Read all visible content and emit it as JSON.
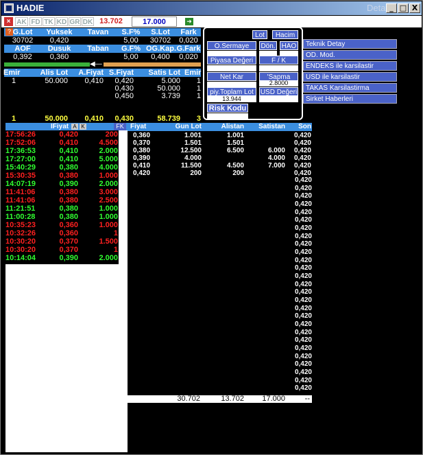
{
  "window": {
    "title": "HADIE",
    "detail": "Detay",
    "buttons": [
      "_",
      "□",
      "X"
    ]
  },
  "toolbar": {
    "tabs": [
      "AK",
      "FD",
      "TK",
      "KD",
      "GR",
      "DK"
    ],
    "price1": "13.702",
    "price2": "17.000"
  },
  "summary": {
    "row1_headers": [
      "G.Lot",
      "Yuksek",
      "Tavan",
      "S.F%",
      "S.Lot",
      "Fark"
    ],
    "row1_values": [
      "30702",
      "0,420",
      "",
      "5,00",
      "30702",
      "0,020"
    ],
    "row2_headers": [
      "AOF",
      "Dusuk",
      "Taban",
      "G.F%",
      "OG.Kap.",
      "G.Fark"
    ],
    "row2_values": [
      "0,392",
      "0,360",
      "",
      "5,00",
      "0,400",
      "0,020"
    ]
  },
  "order_book": {
    "headers": [
      "Emir",
      "Alis Lot",
      "A.Fiyat",
      "S.Fiyat",
      "Satis Lot",
      "Emir"
    ],
    "rows": [
      [
        "1",
        "50.000",
        "0,410",
        "0,420",
        "5.000",
        "1"
      ],
      [
        "",
        "",
        "",
        "0,430",
        "50.000",
        "1"
      ],
      [
        "",
        "",
        "",
        "0,450",
        "3.739",
        "1"
      ]
    ],
    "total": [
      "1",
      "50.000",
      "0,410",
      "0,430",
      "58.739",
      "3"
    ]
  },
  "panel": {
    "lot": "Lot",
    "hacim": "Hacim",
    "o_sermaye": "O.Sermaye",
    "don": "Dön.",
    "hao": "HAO",
    "piyasa_degeri": "Piyasa Değeri",
    "fk": "F / K",
    "net_kar": "Net Kar",
    "sapma_label": "'Sapma",
    "sapma_value": "2.8000",
    "piy_toplam_lot": "piy.Toplam Lot",
    "piy_toplam_value": "13.944",
    "usd_degeri": "USD Değeri",
    "risk_kodu": "Risk Kodu"
  },
  "side_menu": [
    "Teknik Detay",
    "OD. Mod.",
    "ENDEKS ile karsilastir",
    "USD ile karsilastir",
    "TAKAS Karsilastirma",
    "Sirket Haberleri"
  ],
  "trades": {
    "headers": [
      "IFiyat",
      "A",
      "K",
      "FK"
    ],
    "rows": [
      {
        "time": "17:56:26",
        "price": "0,420",
        "lot": "200",
        "color": "#ff2020"
      },
      {
        "time": "17:52:06",
        "price": "0,410",
        "lot": "4.500",
        "color": "#ff2020"
      },
      {
        "time": "17:36:53",
        "price": "0,410",
        "lot": "2.000",
        "color": "#30ff30"
      },
      {
        "time": "17:27:00",
        "price": "0,410",
        "lot": "5.000",
        "color": "#30ff30"
      },
      {
        "time": "15:40:29",
        "price": "0,380",
        "lot": "4.000",
        "color": "#30ff30"
      },
      {
        "time": "15:30:35",
        "price": "0,380",
        "lot": "1.000",
        "color": "#ff2020"
      },
      {
        "time": "14:07:19",
        "price": "0,390",
        "lot": "2.000",
        "color": "#30ff30"
      },
      {
        "time": "11:41:06",
        "price": "0,380",
        "lot": "3.000",
        "color": "#ff2020"
      },
      {
        "time": "11:41:06",
        "price": "0,380",
        "lot": "2.500",
        "color": "#ff2020"
      },
      {
        "time": "11:21:51",
        "price": "0,380",
        "lot": "1.000",
        "color": "#30ff30"
      },
      {
        "time": "11:00:28",
        "price": "0,380",
        "lot": "1.000",
        "color": "#30ff30"
      },
      {
        "time": "10:35:23",
        "price": "0,360",
        "lot": "1.000",
        "color": "#ff2020"
      },
      {
        "time": "10:32:26",
        "price": "0,360",
        "lot": "1",
        "color": "#ff2020"
      },
      {
        "time": "10:30:20",
        "price": "0,370",
        "lot": "1.500",
        "color": "#ff2020"
      },
      {
        "time": "10:30:20",
        "price": "0,370",
        "lot": "1",
        "color": "#ff2020"
      },
      {
        "time": "10:14:04",
        "price": "0,390",
        "lot": "2.000",
        "color": "#30ff30"
      }
    ]
  },
  "depth": {
    "headers": [
      "Fiyat",
      "Gun Lot",
      "Alistan",
      "Satistan",
      "Son"
    ],
    "rows": [
      [
        "0,360",
        "1.001",
        "1.001",
        "",
        "0,420"
      ],
      [
        "0,370",
        "1.501",
        "1.501",
        "",
        "0,420"
      ],
      [
        "0,380",
        "12.500",
        "6.500",
        "6.000",
        "0,420"
      ],
      [
        "0,390",
        "4.000",
        "",
        "4.000",
        "0,420"
      ],
      [
        "0,410",
        "11.500",
        "4.500",
        "7.000",
        "0,420"
      ],
      [
        "0,420",
        "200",
        "200",
        "",
        "0,420"
      ]
    ],
    "son_extra": "0,420",
    "son_extra_count": 27,
    "totals": [
      "30.702",
      "13.702",
      "17.000",
      "--"
    ]
  }
}
